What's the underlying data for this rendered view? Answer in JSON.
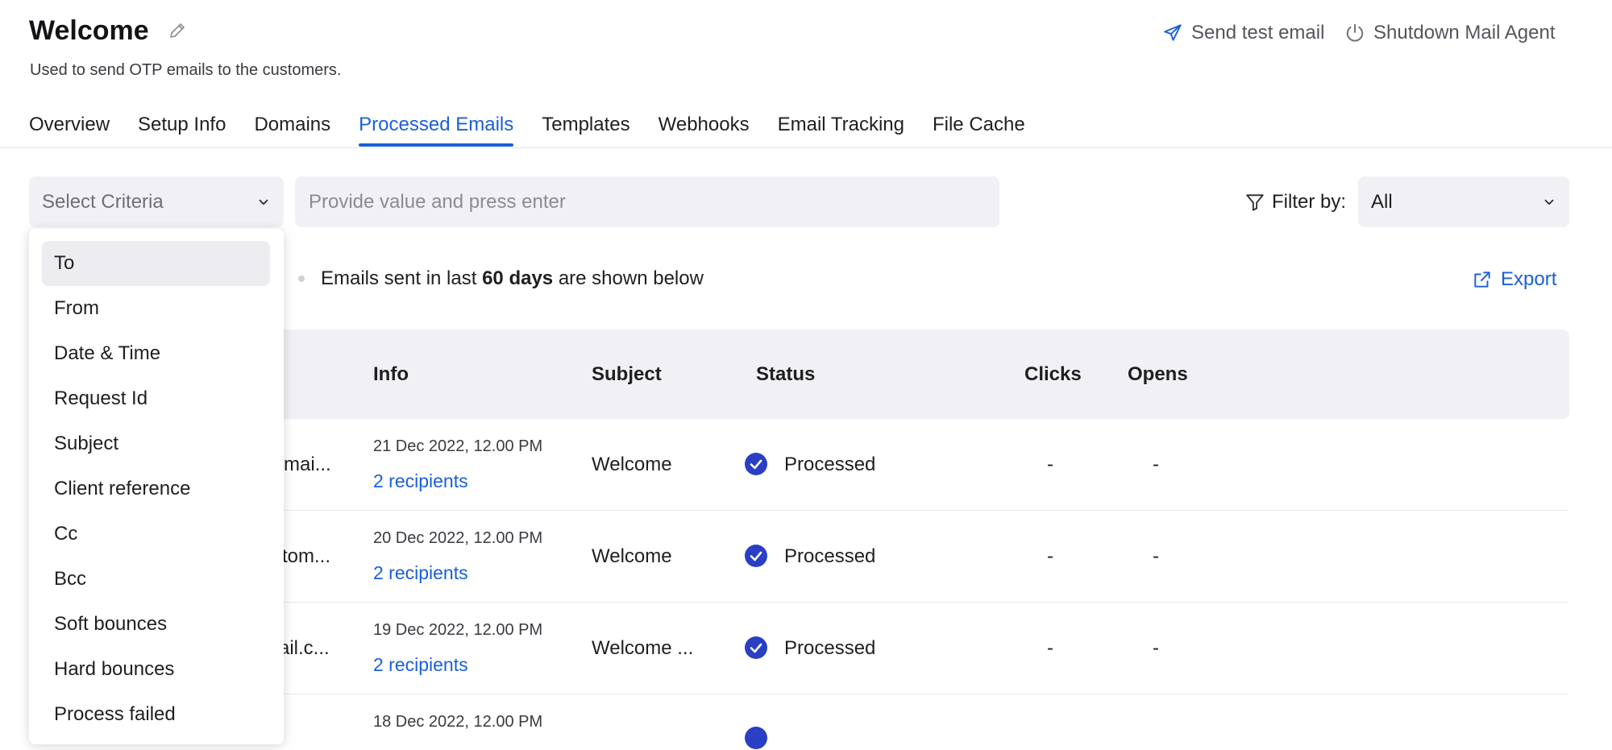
{
  "header": {
    "title": "Welcome",
    "subtitle": "Used to send OTP emails to the customers.",
    "send_test_email": "Send test email",
    "shutdown_agent": "Shutdown Mail Agent"
  },
  "tabs": [
    {
      "label": "Overview",
      "active": false
    },
    {
      "label": "Setup Info",
      "active": false
    },
    {
      "label": "Domains",
      "active": false
    },
    {
      "label": "Processed Emails",
      "active": true
    },
    {
      "label": "Templates",
      "active": false
    },
    {
      "label": "Webhooks",
      "active": false
    },
    {
      "label": "Email Tracking",
      "active": false
    },
    {
      "label": "File Cache",
      "active": false
    }
  ],
  "search": {
    "criteria_placeholder": "Select Criteria",
    "value_placeholder": "Provide value and press enter",
    "filter_label": "Filter by:",
    "filter_value": "All"
  },
  "info": {
    "prefix": "Emails sent in last",
    "highlight": "60 days",
    "suffix": "are shown below",
    "export": "Export"
  },
  "table": {
    "headers": {
      "info": "Info",
      "subject": "Subject",
      "status": "Status",
      "clicks": "Clicks",
      "opens": "Opens"
    },
    "rows": [
      {
        "to_fragment": "mai...",
        "date": "21 Dec 2022, 12.00 PM",
        "recipients": "2 recipients",
        "subject": "Welcome",
        "status": "Processed",
        "clicks": "-",
        "opens": "-"
      },
      {
        "to_fragment": "tom...",
        "date": "20 Dec 2022, 12.00 PM",
        "recipients": "2 recipients",
        "subject": "Welcome",
        "status": "Processed",
        "clicks": "-",
        "opens": "-"
      },
      {
        "to_fragment": "ail.c...",
        "date": "19 Dec 2022, 12.00 PM",
        "recipients": "2 recipients",
        "subject": "Welcome ...",
        "status": "Processed",
        "clicks": "-",
        "opens": "-"
      },
      {
        "to_fragment": "",
        "date": "18 Dec 2022, 12.00 PM",
        "recipients": "",
        "subject": "",
        "status": "",
        "clicks": "",
        "opens": ""
      }
    ]
  },
  "criteria_options": [
    "To",
    "From",
    "Date & Time",
    "Request Id",
    "Subject",
    "Client reference",
    "Cc",
    "Bcc",
    "Soft bounces",
    "Hard bounces",
    "Process failed"
  ],
  "colors": {
    "accent": "#1b5fd9",
    "status_processed": "#2a3fc4",
    "field_bg": "#f1f1f5"
  }
}
